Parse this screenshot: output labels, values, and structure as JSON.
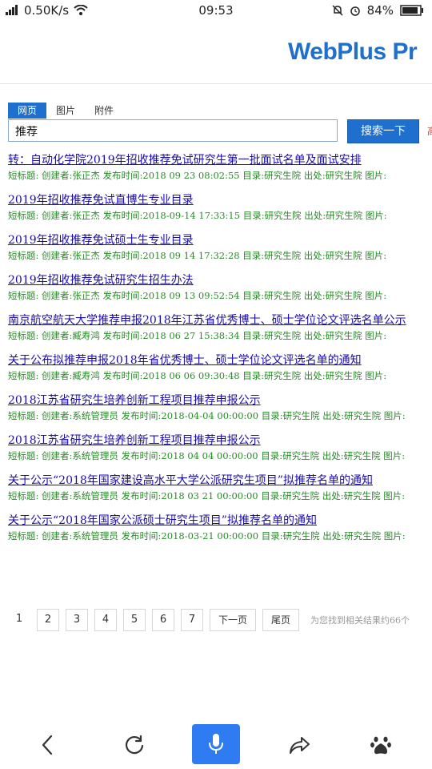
{
  "status_bar": {
    "network_speed": "0.50K/s",
    "time": "09:53",
    "battery": "84%"
  },
  "header": {
    "logo_text": "WebPlus Pr"
  },
  "search": {
    "tabs": [
      {
        "label": "网页",
        "active": true
      },
      {
        "label": "图片",
        "active": false
      },
      {
        "label": "附件",
        "active": false
      }
    ],
    "query": "推荐",
    "button_label": "搜索一下"
  },
  "results": [
    {
      "title": "转：自动化学院2019年招收推荐免试研究生第一批面试名单及面试安排",
      "meta": "短标题:  创建者:张正杰   发布时间:2018 09 23 08:02:55   目录:研究生院   出处:研究生院   图片:"
    },
    {
      "title": "2019年招收推荐免试直博生专业目录",
      "meta": "短标题:  创建者:张正杰   发布时间:2018-09-14 17:33:15   目录:研究生院   出处:研究生院   图片:"
    },
    {
      "title": "2019年招收推荐免试硕士生专业目录",
      "meta": "短标题:  创建者:张正杰   发布时间:2018 09 14 17:32:28   目录:研究生院   出处:研究生院   图片:"
    },
    {
      "title": "2019年招收推荐免试研究生招生办法",
      "meta": "短标题:  创建者:张正杰   发布时间:2018 09 13 09:52:54   目录:研究生院   出处:研究生院   图片:"
    },
    {
      "title": "南京航空航天大学推荐申报2018年江苏省优秀博士、硕士学位论文评选名单公示",
      "meta": "短标题:  创建者:臧寿鸿   发布时间:2018 06 27 15:38:34   目录:研究生院   出处:研究生院   图片:"
    },
    {
      "title": "关于公布拟推荐申报2018年省优秀博士、硕士学位论文评选名单的通知",
      "meta": "短标题:  创建者:臧寿鸿   发布时间:2018 06 06 09:30:48   目录:研究生院   出处:研究生院   图片:"
    },
    {
      "title": "2018江苏省研究生培养创新工程项目推荐申报公示",
      "meta": "短标题:  创建者:系统管理员   发布时间:2018-04-04 00:00:00   目录:研究生院   出处:研究生院   图片:"
    },
    {
      "title": "2018江苏省研究生培养创新工程项目推荐申报公示",
      "meta": "短标题:  创建者:系统管理员   发布时间:2018 04 04 00:00:00   目录:研究生院   出处:研究生院   图片:"
    },
    {
      "title": "关于公示“2018年国家建设高水平大学公派研究生项目”拟推荐名单的通知",
      "meta": "短标题:  创建者:系统管理员   发布时间:2018 03 21 00:00:00   目录:研究生院   出处:研究生院   图片:"
    },
    {
      "title": "关于公示“2018年国家公派硕士研究生项目”拟推荐名单的通知",
      "meta": "短标题:  创建者:系统管理员   发布时间:2018-03-21 00:00:00   目录:研究生院   出处:研究生院   图片:"
    }
  ],
  "pagination": {
    "pages": [
      "1",
      "2",
      "3",
      "4",
      "5",
      "6",
      "7"
    ],
    "current": "1",
    "next_label": "下一页",
    "last_label": "尾页",
    "total_text": "为您找到相关结果约66个"
  },
  "bottom_nav": {
    "icons": [
      "back-icon",
      "refresh-icon",
      "microphone-icon",
      "share-icon",
      "baidu-paw-icon"
    ]
  }
}
